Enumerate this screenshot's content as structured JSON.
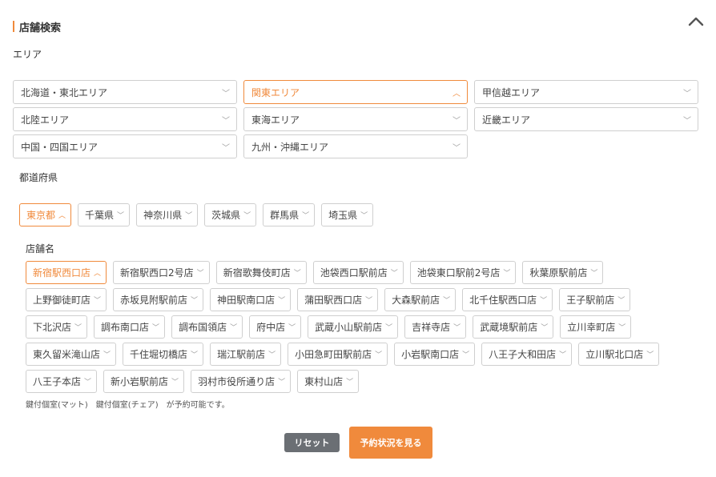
{
  "header": {
    "title": "店舗検索"
  },
  "area": {
    "label": "エリア",
    "items": [
      {
        "label": "北海道・東北エリア"
      },
      {
        "label": "関東エリア"
      },
      {
        "label": "甲信越エリア"
      },
      {
        "label": "北陸エリア"
      },
      {
        "label": "東海エリア"
      },
      {
        "label": "近畿エリア"
      },
      {
        "label": "中国・四国エリア"
      },
      {
        "label": "九州・沖縄エリア"
      }
    ]
  },
  "prefecture": {
    "label": "都道府県",
    "items": [
      {
        "label": "東京都"
      },
      {
        "label": "千葉県"
      },
      {
        "label": "神奈川県"
      },
      {
        "label": "茨城県"
      },
      {
        "label": "群馬県"
      },
      {
        "label": "埼玉県"
      }
    ]
  },
  "store": {
    "label": "店舗名",
    "items": [
      {
        "label": "新宿駅西口店"
      },
      {
        "label": "新宿駅西口2号店"
      },
      {
        "label": "新宿歌舞伎町店"
      },
      {
        "label": "池袋西口駅前店"
      },
      {
        "label": "池袋東口駅前2号店"
      },
      {
        "label": "秋葉原駅前店"
      },
      {
        "label": "上野御徒町店"
      },
      {
        "label": "赤坂見附駅前店"
      },
      {
        "label": "神田駅南口店"
      },
      {
        "label": "蒲田駅西口店"
      },
      {
        "label": "大森駅前店"
      },
      {
        "label": "北千住駅西口店"
      },
      {
        "label": "王子駅前店"
      },
      {
        "label": "下北沢店"
      },
      {
        "label": "調布南口店"
      },
      {
        "label": "調布国領店"
      },
      {
        "label": "府中店"
      },
      {
        "label": "武蔵小山駅前店"
      },
      {
        "label": "吉祥寺店"
      },
      {
        "label": "武蔵境駅前店"
      },
      {
        "label": "立川幸町店"
      },
      {
        "label": "東久留米滝山店"
      },
      {
        "label": "千住堀切橋店"
      },
      {
        "label": "瑞江駅前店"
      },
      {
        "label": "小田急町田駅前店"
      },
      {
        "label": "小岩駅南口店"
      },
      {
        "label": "八王子大和田店"
      },
      {
        "label": "立川駅北口店"
      },
      {
        "label": "八王子本店"
      },
      {
        "label": "新小岩駅前店"
      },
      {
        "label": "羽村市役所通り店"
      },
      {
        "label": "東村山店"
      }
    ],
    "note": "鍵付個室(マット)　鍵付個室(チェア)　が予約可能です。"
  },
  "buttons": {
    "reset": "リセット",
    "submit": "予約状況を見る"
  },
  "colors": {
    "accent": "#f08a3c",
    "reset": "#6b6f74",
    "border": "#cfcfcf"
  },
  "icons": {
    "collapse": "chevron-up-icon",
    "expand": "chevron-down-icon"
  }
}
